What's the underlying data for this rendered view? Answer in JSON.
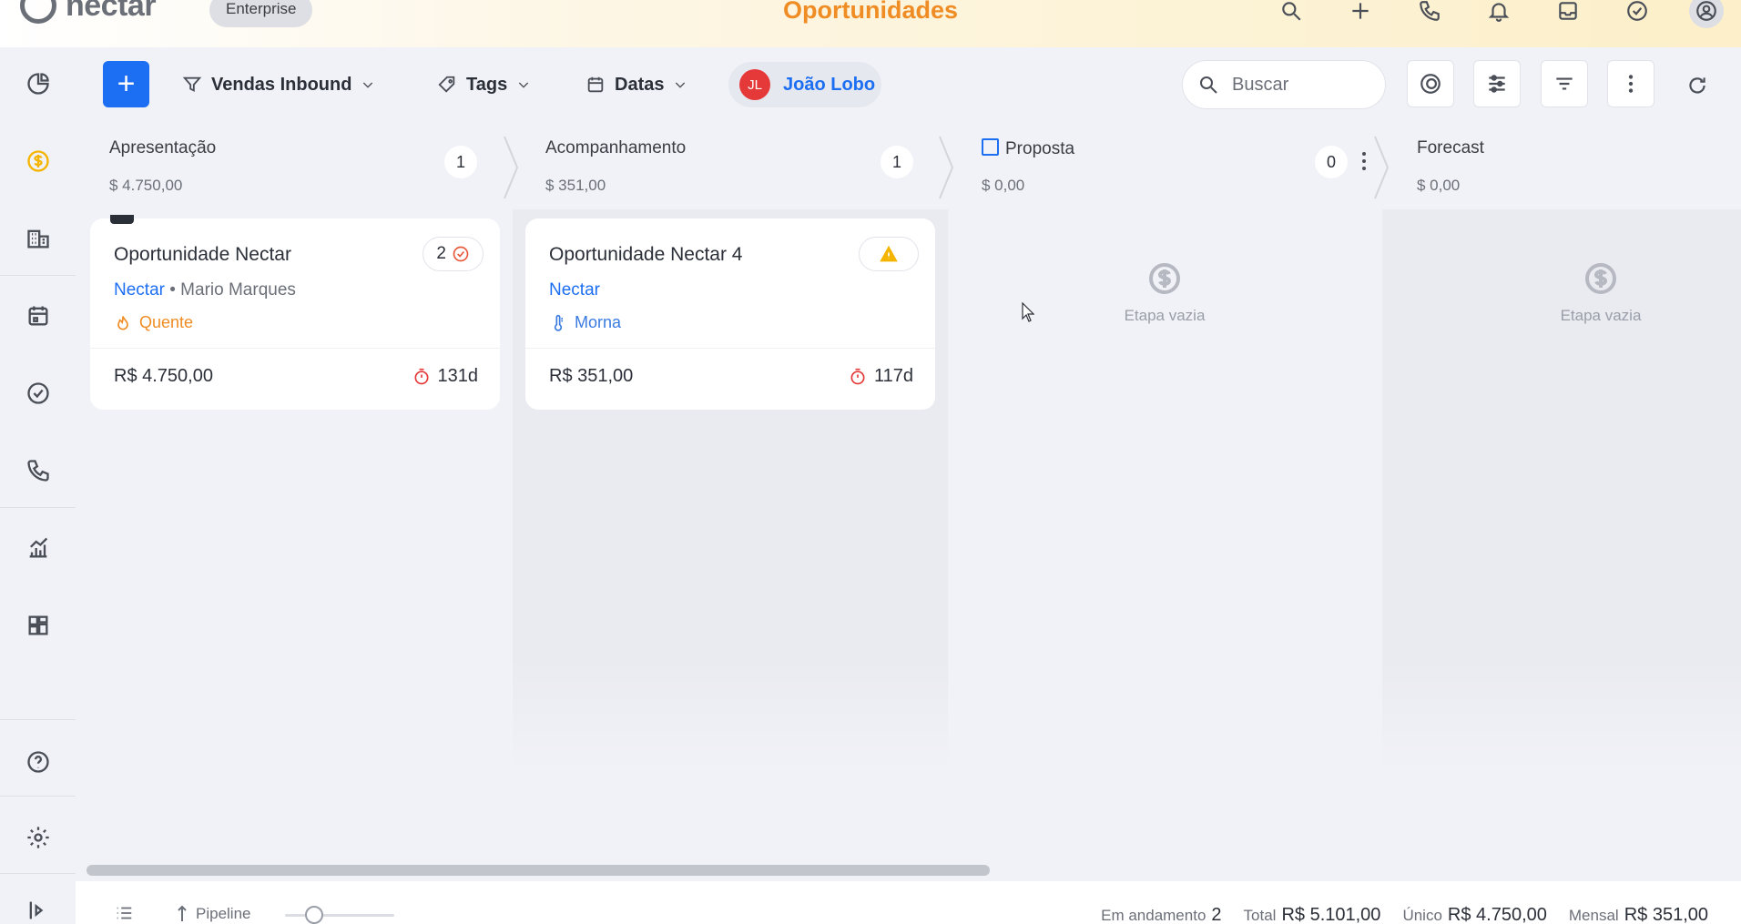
{
  "app": {
    "brand": "nectar",
    "plan": "Enterprise",
    "page_title": "Oportunidades"
  },
  "top_icons": [
    "search-icon",
    "plus-icon",
    "phone-icon",
    "bell-icon",
    "inbox-icon",
    "check-circle-icon",
    "account-icon"
  ],
  "sidebar": {
    "items": [
      "pie-chart-icon",
      "dollar-icon",
      "building-icon",
      "calendar-icon",
      "check-circle-icon",
      "phone-icon",
      "analytics-icon",
      "dashboard-icon",
      "help-icon",
      "settings-icon",
      "expand-icon"
    ],
    "active": "dollar-icon"
  },
  "toolbar": {
    "add_label": "+",
    "pipeline_filter": "Vendas Inbound",
    "tags_label": "Tags",
    "dates_label": "Datas",
    "user_initials": "JL",
    "user_name": "João Lobo",
    "search_placeholder": "Buscar"
  },
  "columns": [
    {
      "name": "Apresentação",
      "total": "$ 4.750,00",
      "count": "1",
      "cards": [
        {
          "title": "Oportunidade Nectar",
          "company": "Nectar",
          "contact": "• Mario Marques",
          "temperature": "Quente",
          "value": "R$ 4.750,00",
          "age": "131d",
          "badge": "2"
        }
      ]
    },
    {
      "name": "Acompanhamento",
      "total": "$ 351,00",
      "count": "1",
      "cards": [
        {
          "title": "Oportunidade Nectar 4",
          "company": "Nectar",
          "contact": "",
          "temperature": "Morna",
          "value": "R$ 351,00",
          "age": "117d",
          "badge": ""
        }
      ]
    },
    {
      "name": "Proposta",
      "total": "$ 0,00",
      "count": "0",
      "empty_label": "Etapa vazia",
      "cards": []
    },
    {
      "name": "Forecast",
      "total": "$ 0,00",
      "count": "",
      "empty_label": "Etapa vazia",
      "cards": []
    }
  ],
  "footer": {
    "view_label": "Pipeline",
    "stats": [
      {
        "label": "Em andamento",
        "value": "2"
      },
      {
        "label": "Total",
        "value": "R$ 5.101,00"
      },
      {
        "label": "Único",
        "value": "R$ 4.750,00"
      },
      {
        "label": "Mensal",
        "value": "R$ 351,00"
      }
    ]
  },
  "colors": {
    "accent": "#1c6ef2",
    "title": "#f08c24",
    "hot": "#f08c24",
    "warm": "#3a7be0",
    "alert": "#f4b400",
    "danger": "#e53939"
  }
}
